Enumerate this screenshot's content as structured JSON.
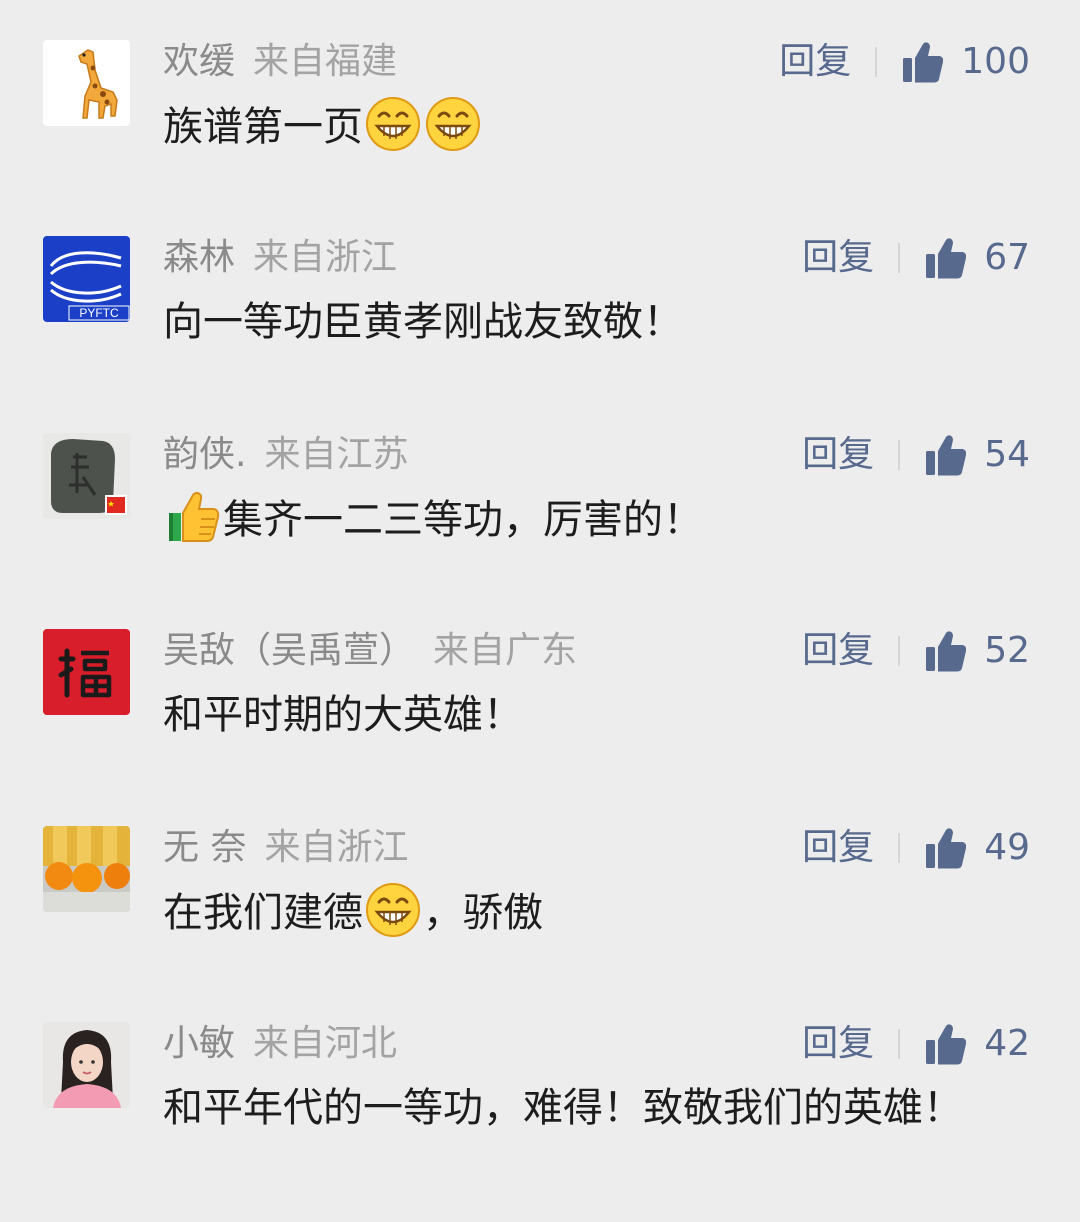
{
  "reply_label": "回复",
  "colors": {
    "background": "#ededed",
    "name": "#8a8a8a",
    "link": "#58698e",
    "text": "#1d1d1d"
  },
  "comments": [
    {
      "avatar": "giraffe-avatar",
      "name": "欢缓",
      "location": "来自福建",
      "likes": "100",
      "text_parts": [
        "族谱第一页",
        "grin-emoji",
        "grin-emoji"
      ]
    },
    {
      "avatar": "pyftc-logo-avatar",
      "name": "森林",
      "location": "来自浙江",
      "likes": "67",
      "text_parts": [
        "向一等功臣黄孝刚战友致敬！"
      ]
    },
    {
      "avatar": "stone-seal-avatar",
      "name": "韵侠.",
      "location": "来自江苏",
      "likes": "54",
      "text_parts": [
        "thumbs-up-emoji",
        "集齐一二三等功，厉害的！"
      ]
    },
    {
      "avatar": "fu-character-avatar",
      "name": "吴敌（吴禹萱）",
      "location": "来自广东",
      "likes": "52",
      "text_parts": [
        "和平时期的大英雄！"
      ]
    },
    {
      "avatar": "oranges-avatar",
      "name": "无 奈",
      "location": "来自浙江",
      "likes": "49",
      "text_parts": [
        "在我们建德",
        "grin-emoji",
        "，骄傲"
      ]
    },
    {
      "avatar": "girl-photo-avatar",
      "name": "小敏",
      "location": "来自河北",
      "likes": "42",
      "text_parts": [
        "和平年代的一等功，难得！致敬我们的英雄！"
      ]
    }
  ]
}
